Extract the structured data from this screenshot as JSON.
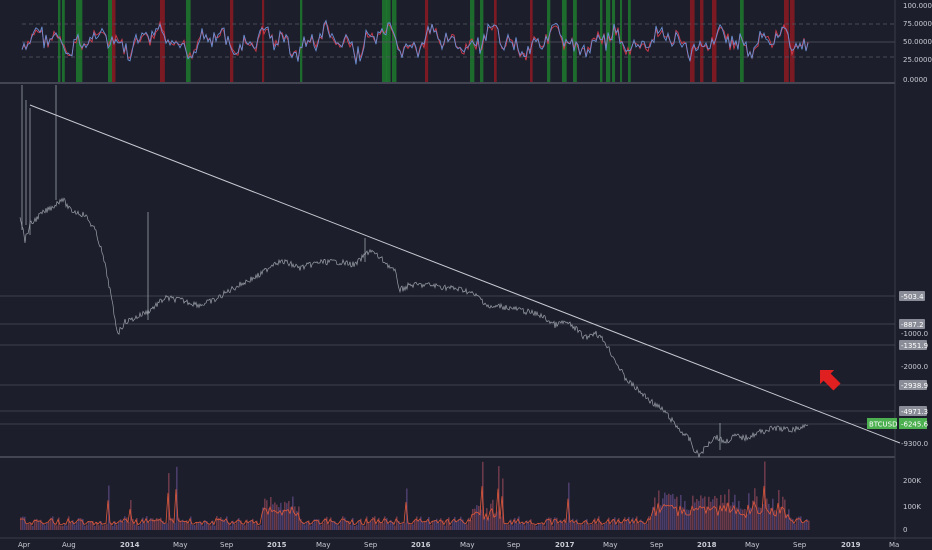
{
  "oscillator_panel": {
    "scale_labels": [
      "100.0000",
      "75.0000",
      "50.0000",
      "25.0000",
      "0.0000"
    ],
    "scale_values": [
      100,
      75,
      50,
      25,
      0
    ]
  },
  "price_panel": {
    "price_labels": [
      {
        "text": "-503.4",
        "boxed": true
      },
      {
        "text": "-887.2",
        "boxed": true
      },
      {
        "text": "-1000.0",
        "boxed": false
      },
      {
        "text": "-1351.9",
        "boxed": true
      },
      {
        "text": "-2000.0",
        "boxed": false
      },
      {
        "text": "-2938.9",
        "boxed": true
      },
      {
        "text": "-4971.3",
        "boxed": true
      },
      {
        "text": "-6245.6",
        "boxed": true
      },
      {
        "text": "-9300.0",
        "boxed": false
      }
    ],
    "symbol_tag": {
      "symbol": "BTCUSD",
      "value": "-6245.6",
      "color": "#4caf50"
    },
    "arrow_color": "#e02020"
  },
  "volume_panel": {
    "scale_labels": [
      "200K",
      "100K",
      "0"
    ]
  },
  "time_axis": {
    "labels": [
      "Apr",
      "Aug",
      "2014",
      "May",
      "Sep",
      "2015",
      "May",
      "Sep",
      "2016",
      "May",
      "Sep",
      "2017",
      "May",
      "Sep",
      "2018",
      "May",
      "Sep",
      "2019",
      "Ma"
    ]
  },
  "colors": {
    "background": "#1c1e2b",
    "grid_line": "#4a4d5c",
    "trendline": "#c8cad2",
    "price_series": "#9aa0a8",
    "osc_blue": "#6b8fd4",
    "osc_red": "#d23b4b",
    "osc_green_band": "#1e7a2e",
    "osc_red_band": "#8c1a22",
    "volume_fill": "#5a3a5a",
    "volume_line": "#e0583a"
  }
}
